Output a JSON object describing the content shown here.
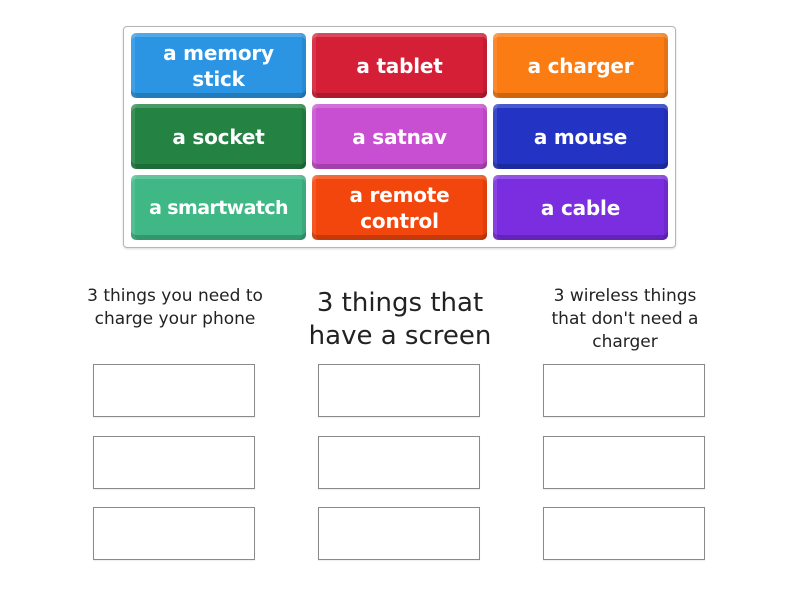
{
  "tiles": [
    {
      "label": "a memory stick",
      "color": "#2b95e3"
    },
    {
      "label": "a tablet",
      "color": "#d41f36"
    },
    {
      "label": "a charger",
      "color": "#fb7c13"
    },
    {
      "label": "a socket",
      "color": "#248343"
    },
    {
      "label": "a satnav",
      "color": "#c94fd2"
    },
    {
      "label": "a mouse",
      "color": "#2334c4"
    },
    {
      "label": "a smartwatch",
      "color": "#3fb886"
    },
    {
      "label": "a remote control",
      "color": "#f2460c"
    },
    {
      "label": "a cable",
      "color": "#7b2de0"
    }
  ],
  "groups": [
    {
      "title": "3 things you need to charge your phone",
      "slots": [
        "",
        "",
        ""
      ]
    },
    {
      "title": "3 things that have a screen",
      "slots": [
        "",
        "",
        ""
      ]
    },
    {
      "title": "3 wireless things that don't need a charger",
      "slots": [
        "",
        "",
        ""
      ]
    }
  ]
}
